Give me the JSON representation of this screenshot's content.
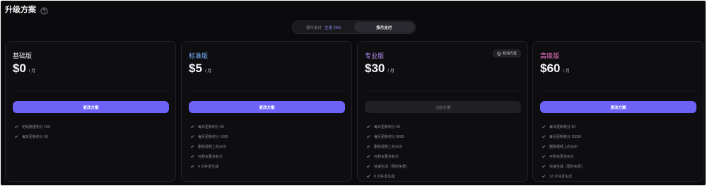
{
  "header": {
    "title": "升级方案",
    "help_icon": "question-circle-icon"
  },
  "billing_toggle": {
    "yearly_label": "按年支付",
    "yearly_save": "立省 20%",
    "monthly_label": "按月支付",
    "selected": "monthly"
  },
  "plans": [
    {
      "name": "基础版",
      "name_color": "#e8e8ea",
      "price": "$0",
      "unit": "/ 月",
      "button": "更改方案",
      "features": [
        "初始赠送积分 100",
        "每日更新积分 50"
      ]
    },
    {
      "name": "标准版",
      "name_color": "#7db6ff",
      "price": "$5",
      "unit": "/ 月",
      "button": "更改方案",
      "features": [
        "每日更新积分 50",
        "每月更新积分 1000",
        "删除视频上的水印",
        "可购买更多积分",
        "4 次并发生成"
      ]
    },
    {
      "name": "专业版",
      "name_color": "#b892ff",
      "price": "$30",
      "unit": "/ 月",
      "button": "当前方案",
      "badge": "取消方案",
      "features": [
        "每日更新积分 50",
        "每月更新积分 8000",
        "删除视频上的水印",
        "可购买更多积分",
        "快速生成（限时免费）",
        "8 次并发生成"
      ]
    },
    {
      "name": "高级版",
      "name_color": "#ff7bd0",
      "price": "$60",
      "unit": "/ 月",
      "button": "更改方案",
      "features": [
        "每日更新积分 50",
        "每月更新积分 15000",
        "删除视频上的水印",
        "可购买更多积分",
        "快速生成（限时免费）",
        "12 次并发生成"
      ]
    }
  ],
  "colors": {
    "accent": "#6c63f5",
    "background": "#0b0b0d"
  }
}
